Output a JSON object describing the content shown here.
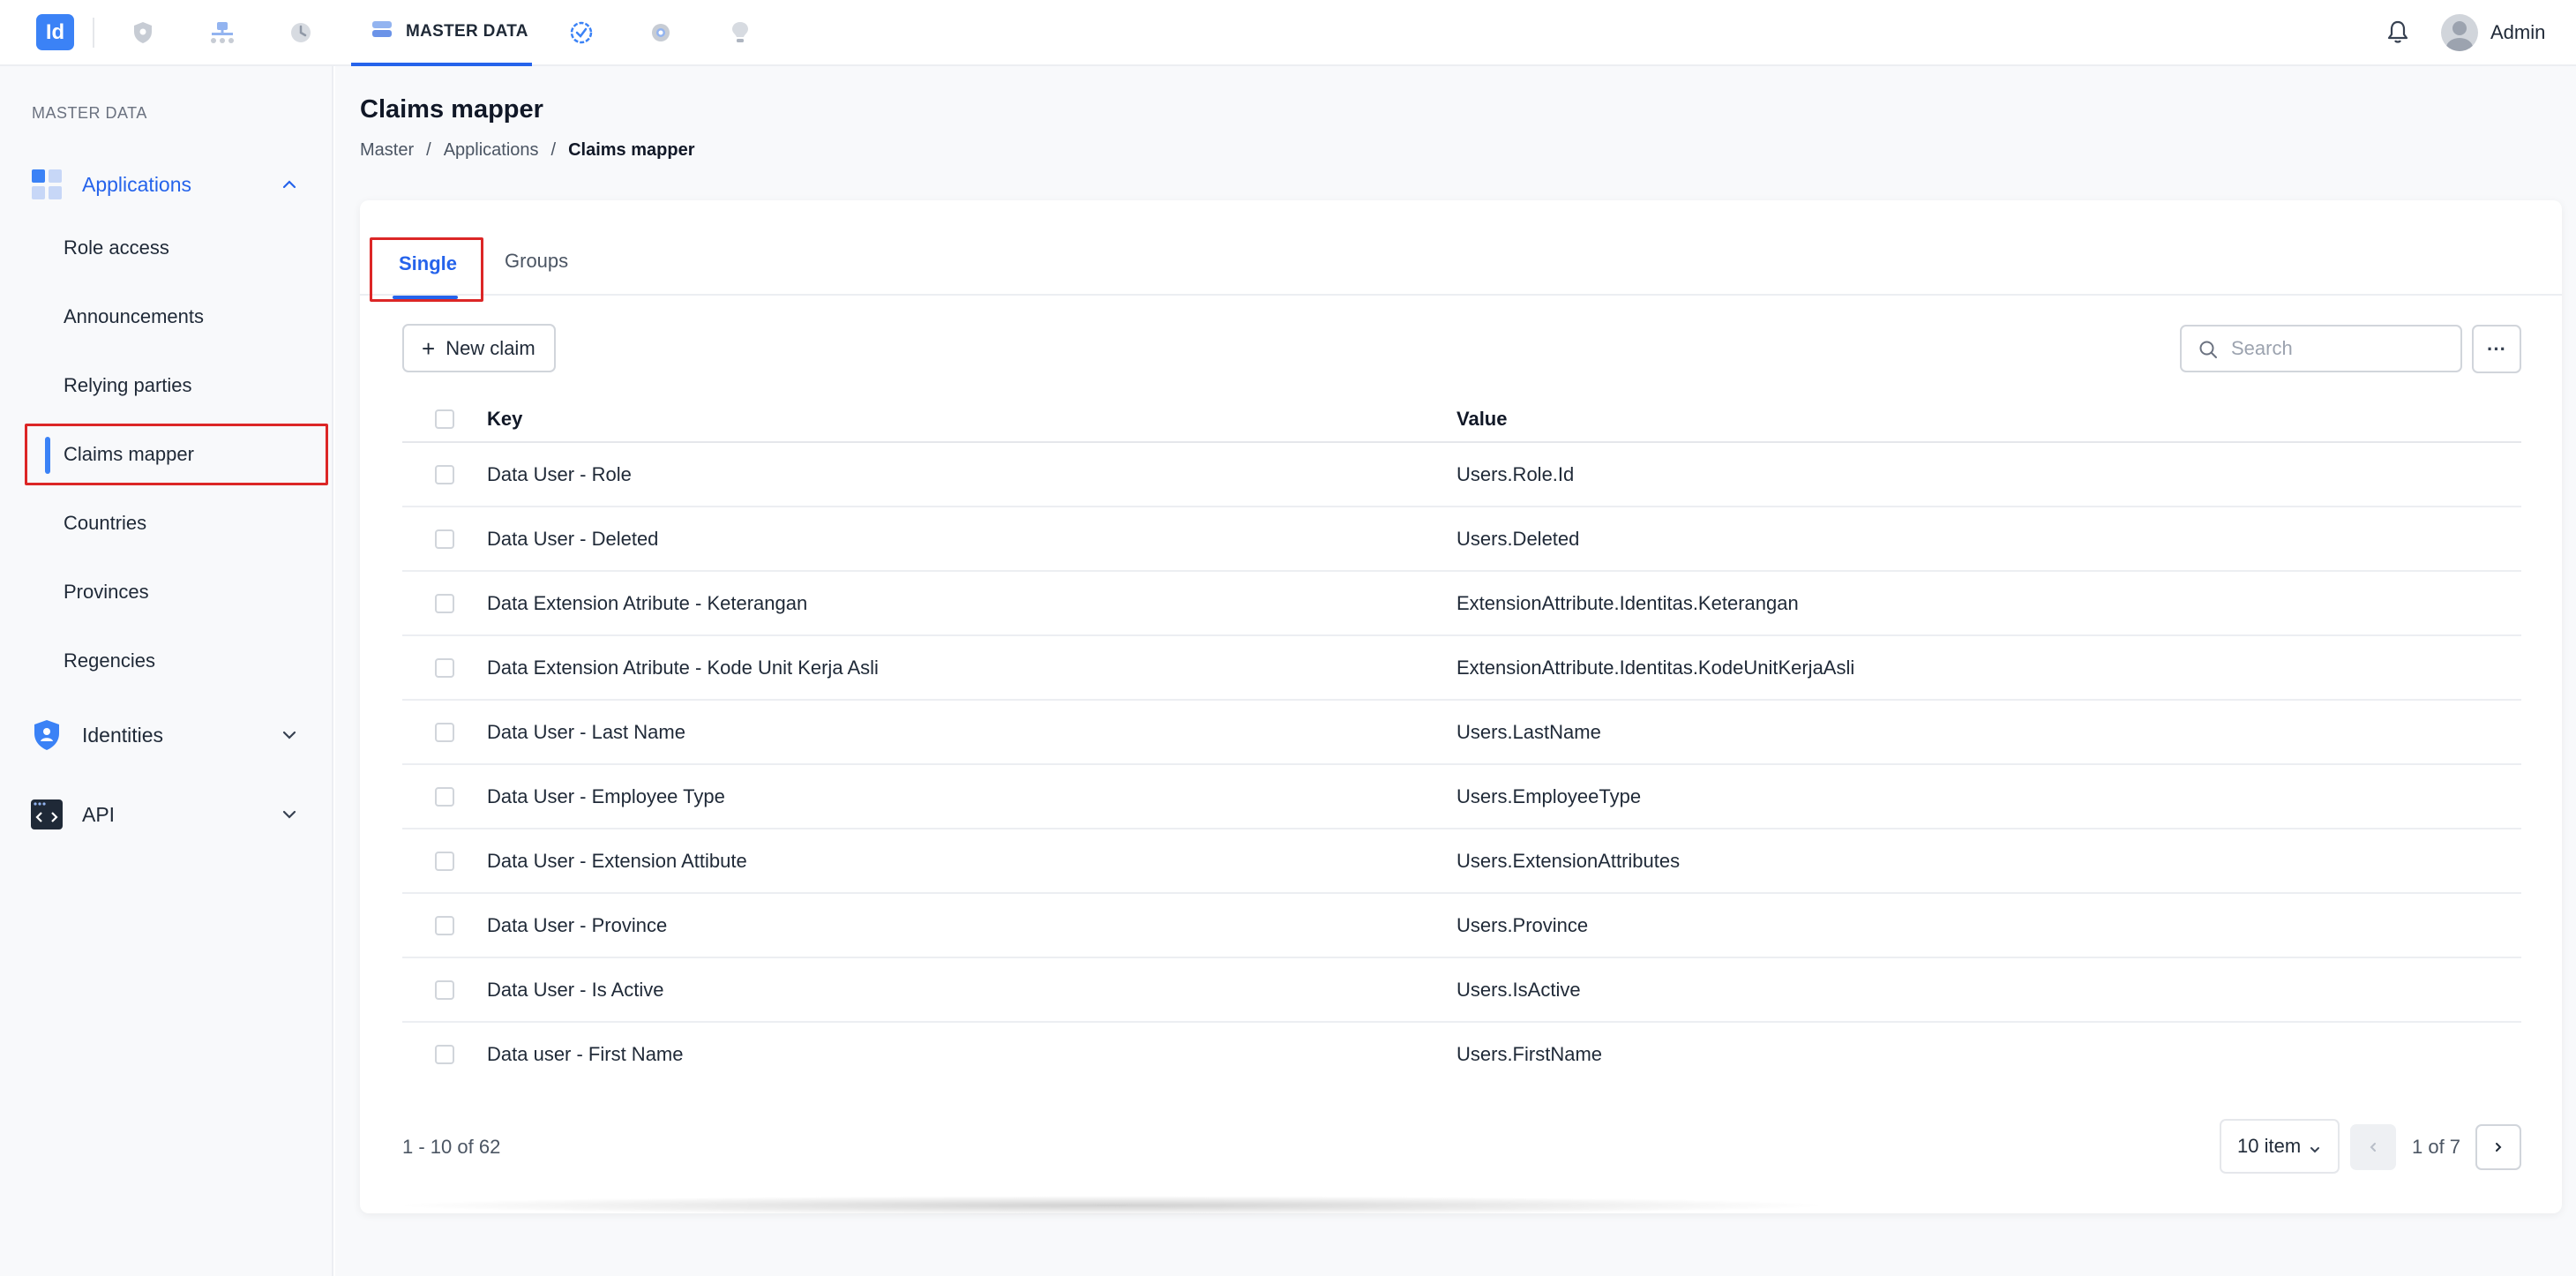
{
  "topnav": {
    "logo_text": "Id",
    "active_tab_label": "MASTER DATA",
    "icons": [
      "shield-icon",
      "network-icon",
      "history-icon",
      "database-icon",
      "check-badge-icon",
      "settings-icon",
      "lightbulb-icon",
      "bell-icon"
    ],
    "user_name": "Admin"
  },
  "sidebar": {
    "section_label": "MASTER DATA",
    "groups": [
      {
        "label": "Applications",
        "icon": "grid-apps-icon",
        "expanded": true
      },
      {
        "label": "Identities",
        "icon": "identity-shield-icon",
        "expanded": false
      },
      {
        "label": "API",
        "icon": "code-window-icon",
        "expanded": false
      }
    ],
    "items": [
      {
        "label": "Role access"
      },
      {
        "label": "Announcements"
      },
      {
        "label": "Relying parties"
      },
      {
        "label": "Claims mapper",
        "active": true
      },
      {
        "label": "Countries"
      },
      {
        "label": "Provinces"
      },
      {
        "label": "Regencies"
      }
    ]
  },
  "page": {
    "title": "Claims mapper",
    "breadcrumb": [
      "Master",
      "Applications",
      "Claims mapper"
    ],
    "breadcrumb_sep": "/"
  },
  "tabs": {
    "single": "Single",
    "groups": "Groups",
    "active": "Single"
  },
  "toolbar": {
    "new_claim_label": "New claim",
    "search_placeholder": "Search",
    "more_label": "···"
  },
  "table": {
    "headers": {
      "key": "Key",
      "value": "Value"
    },
    "rows": [
      {
        "key": "Data User - Role",
        "value": "Users.Role.Id"
      },
      {
        "key": "Data User - Deleted",
        "value": "Users.Deleted"
      },
      {
        "key": "Data Extension Atribute - Keterangan",
        "value": "ExtensionAttribute.Identitas.Keterangan"
      },
      {
        "key": "Data Extension Atribute - Kode Unit Kerja Asli",
        "value": "ExtensionAttribute.Identitas.KodeUnitKerjaAsli"
      },
      {
        "key": "Data User - Last Name",
        "value": "Users.LastName"
      },
      {
        "key": "Data User - Employee Type",
        "value": "Users.EmployeeType"
      },
      {
        "key": "Data User - Extension Attibute",
        "value": "Users.ExtensionAttributes"
      },
      {
        "key": "Data User - Province",
        "value": "Users.Province"
      },
      {
        "key": "Data User - Is Active",
        "value": "Users.IsActive"
      },
      {
        "key": "Data user - First Name",
        "value": "Users.FirstName"
      }
    ]
  },
  "pagination": {
    "range_text": "1 - 10 of 62",
    "per_page": "10 item",
    "page_info": "1 of 7"
  },
  "colors": {
    "accent": "#2563eb",
    "highlight_border": "#dc2626",
    "sidebar_bg": "#f8f9fb"
  }
}
